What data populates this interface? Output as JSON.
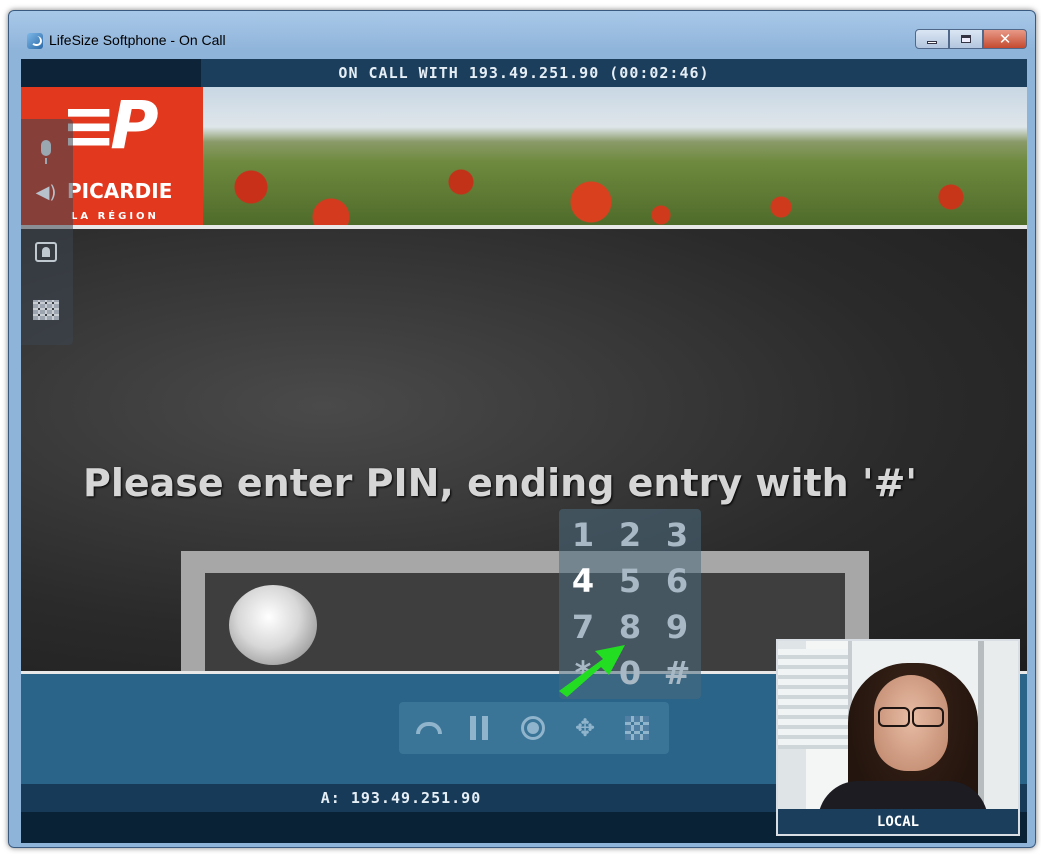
{
  "window": {
    "title": "LifeSize Softphone - On Call",
    "icon": "lifesize-app-icon",
    "controls": {
      "minimize": "minimize-icon",
      "maximize": "maximize-icon",
      "close": "close-icon",
      "close_glyph": "✕"
    }
  },
  "call": {
    "header": "ON CALL WITH 193.49.251.90 (00:02:46)",
    "remote_address": "A: 193.49.251.90"
  },
  "banner": {
    "logo_mark": "≡P",
    "logo_name": "PICARDIE",
    "logo_sub": "LA RÉGION"
  },
  "side_controls": [
    "microphone-icon",
    "speaker-icon",
    "camera-icon",
    "layout-icon"
  ],
  "ivr": {
    "prompt": "Please enter PIN, ending entry with '#'"
  },
  "dialpad": {
    "keys": [
      "1",
      "2",
      "3",
      "4",
      "5",
      "6",
      "7",
      "8",
      "9",
      "*",
      "0",
      "#"
    ],
    "highlighted": "4"
  },
  "call_controls": [
    "hangup-icon",
    "pause-icon",
    "record-icon",
    "move-icon",
    "keypad-icon"
  ],
  "local_video": {
    "label": "LOCAL"
  },
  "colors": {
    "accent": "#2a6488",
    "pointer_arrow": "#22dd22",
    "logo_red": "#e2381e"
  }
}
